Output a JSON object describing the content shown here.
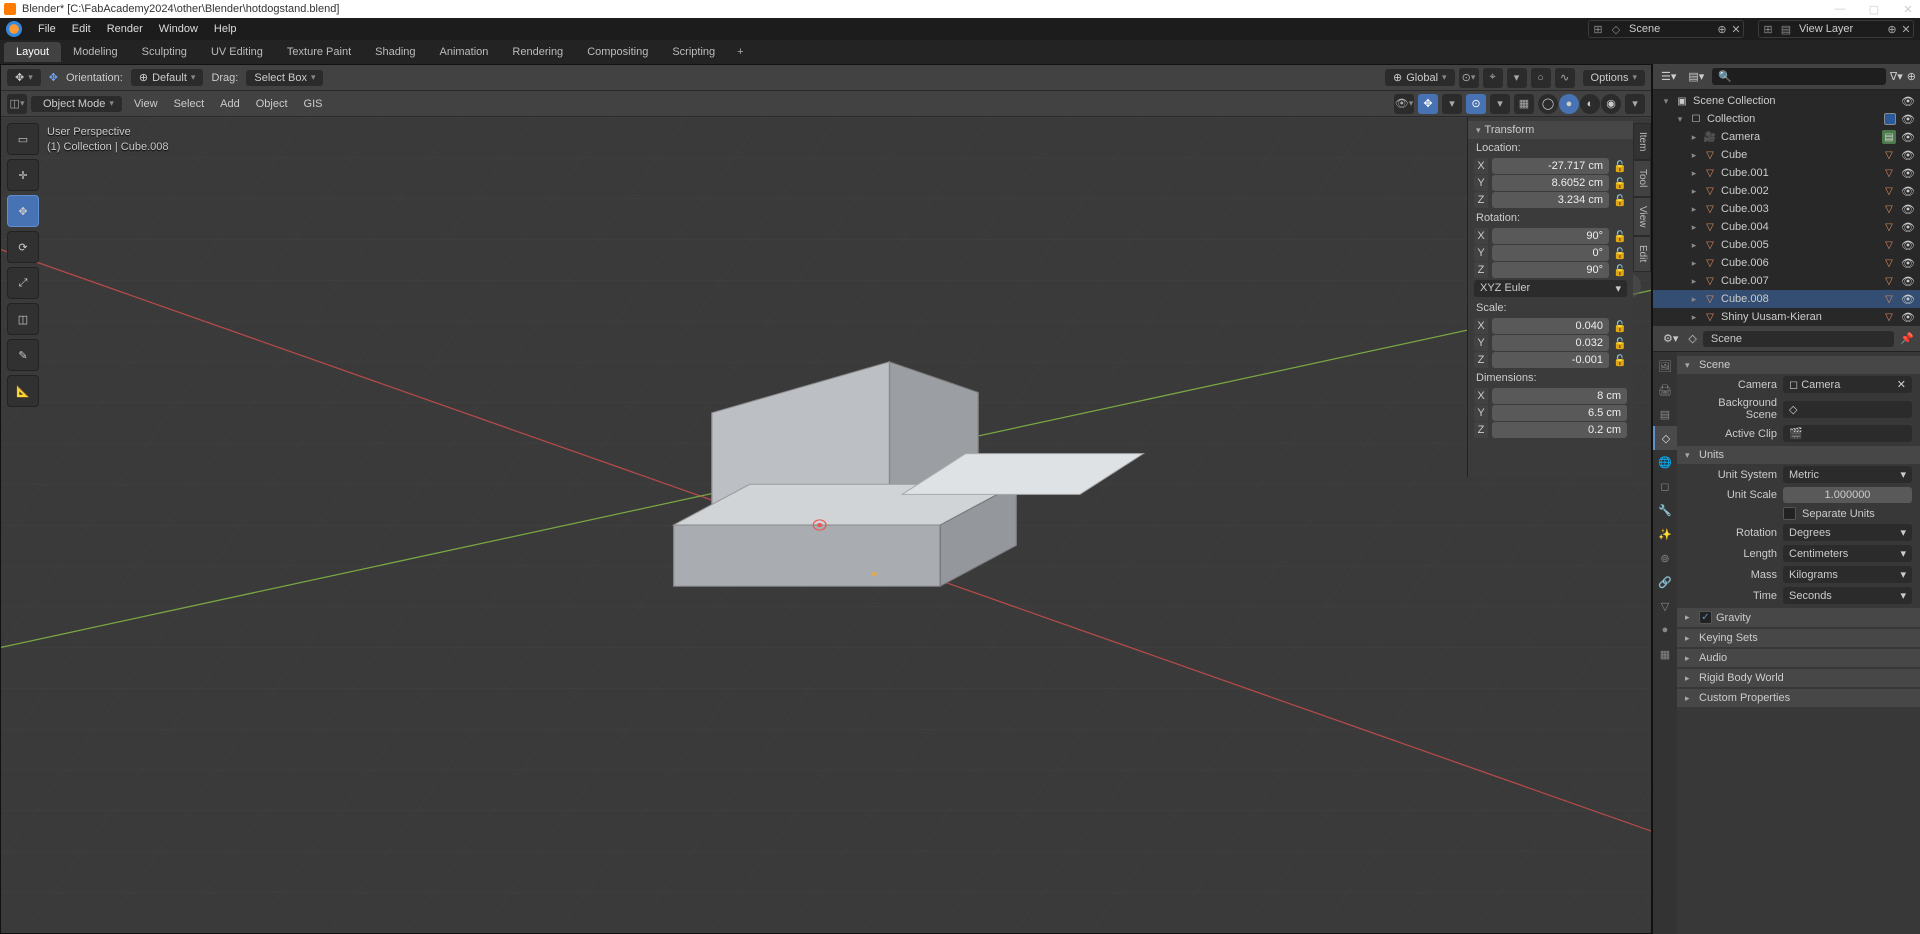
{
  "title": "Blender* [C:\\FabAcademy2024\\other\\Blender\\hotdogstand.blend]",
  "topmenu": [
    "File",
    "Edit",
    "Render",
    "Window",
    "Help"
  ],
  "scene_name": "Scene",
  "viewlayer_name": "View Layer",
  "workspaces": [
    "Layout",
    "Modeling",
    "Sculpting",
    "UV Editing",
    "Texture Paint",
    "Shading",
    "Animation",
    "Rendering",
    "Compositing",
    "Scripting"
  ],
  "active_workspace": "Layout",
  "vp_header": {
    "orientation_label": "Orientation:",
    "orientation_value": "Default",
    "drag_label": "Drag:",
    "drag_value": "Select Box",
    "transform_space": "Global",
    "options": "Options"
  },
  "vp_sub": {
    "mode": "Object Mode",
    "menus": [
      "View",
      "Select",
      "Add",
      "Object",
      "GIS"
    ]
  },
  "overlay": {
    "line1": "User Perspective",
    "line2": "(1) Collection | Cube.008"
  },
  "side_tabs": [
    "Item",
    "Tool",
    "View",
    "Edit"
  ],
  "npanel": {
    "title": "Transform",
    "location_label": "Location:",
    "loc": {
      "X": "-27.717 cm",
      "Y": "8.6052 cm",
      "Z": "3.234 cm"
    },
    "rotation_label": "Rotation:",
    "rot": {
      "X": "90°",
      "Y": "0°",
      "Z": "90°"
    },
    "rotmode": "XYZ Euler",
    "scale_label": "Scale:",
    "scale": {
      "X": "0.040",
      "Y": "0.032",
      "Z": "-0.001"
    },
    "dim_label": "Dimensions:",
    "dim": {
      "X": "8 cm",
      "Y": "6.5 cm",
      "Z": "0.2 cm"
    }
  },
  "outliner": {
    "root": "Scene Collection",
    "collection": "Collection",
    "items": [
      {
        "name": "Camera",
        "icon": "camera",
        "highlight": true
      },
      {
        "name": "Cube",
        "icon": "mesh"
      },
      {
        "name": "Cube.001",
        "icon": "mesh"
      },
      {
        "name": "Cube.002",
        "icon": "mesh"
      },
      {
        "name": "Cube.003",
        "icon": "mesh"
      },
      {
        "name": "Cube.004",
        "icon": "mesh"
      },
      {
        "name": "Cube.005",
        "icon": "mesh"
      },
      {
        "name": "Cube.006",
        "icon": "mesh"
      },
      {
        "name": "Cube.007",
        "icon": "mesh"
      },
      {
        "name": "Cube.008",
        "icon": "mesh",
        "selected": true
      },
      {
        "name": "Shiny Uusam-Kieran",
        "icon": "mesh"
      }
    ]
  },
  "props": {
    "crumb": "Scene",
    "scene_section": "Scene",
    "camera_label": "Camera",
    "camera_value": "Camera",
    "bgscene_label": "Background Scene",
    "bgscene_value": "",
    "clip_label": "Active Clip",
    "clip_value": "",
    "units_section": "Units",
    "unitsystem_label": "Unit System",
    "unitsystem_value": "Metric",
    "unitscale_label": "Unit Scale",
    "unitscale_value": "1.000000",
    "separate_label": "Separate Units",
    "rotation_label": "Rotation",
    "rotation_value": "Degrees",
    "length_label": "Length",
    "length_value": "Centimeters",
    "mass_label": "Mass",
    "mass_value": "Kilograms",
    "time_label": "Time",
    "time_value": "Seconds",
    "collapsed": [
      "Gravity",
      "Keying Sets",
      "Audio",
      "Rigid Body World",
      "Custom Properties"
    ]
  }
}
